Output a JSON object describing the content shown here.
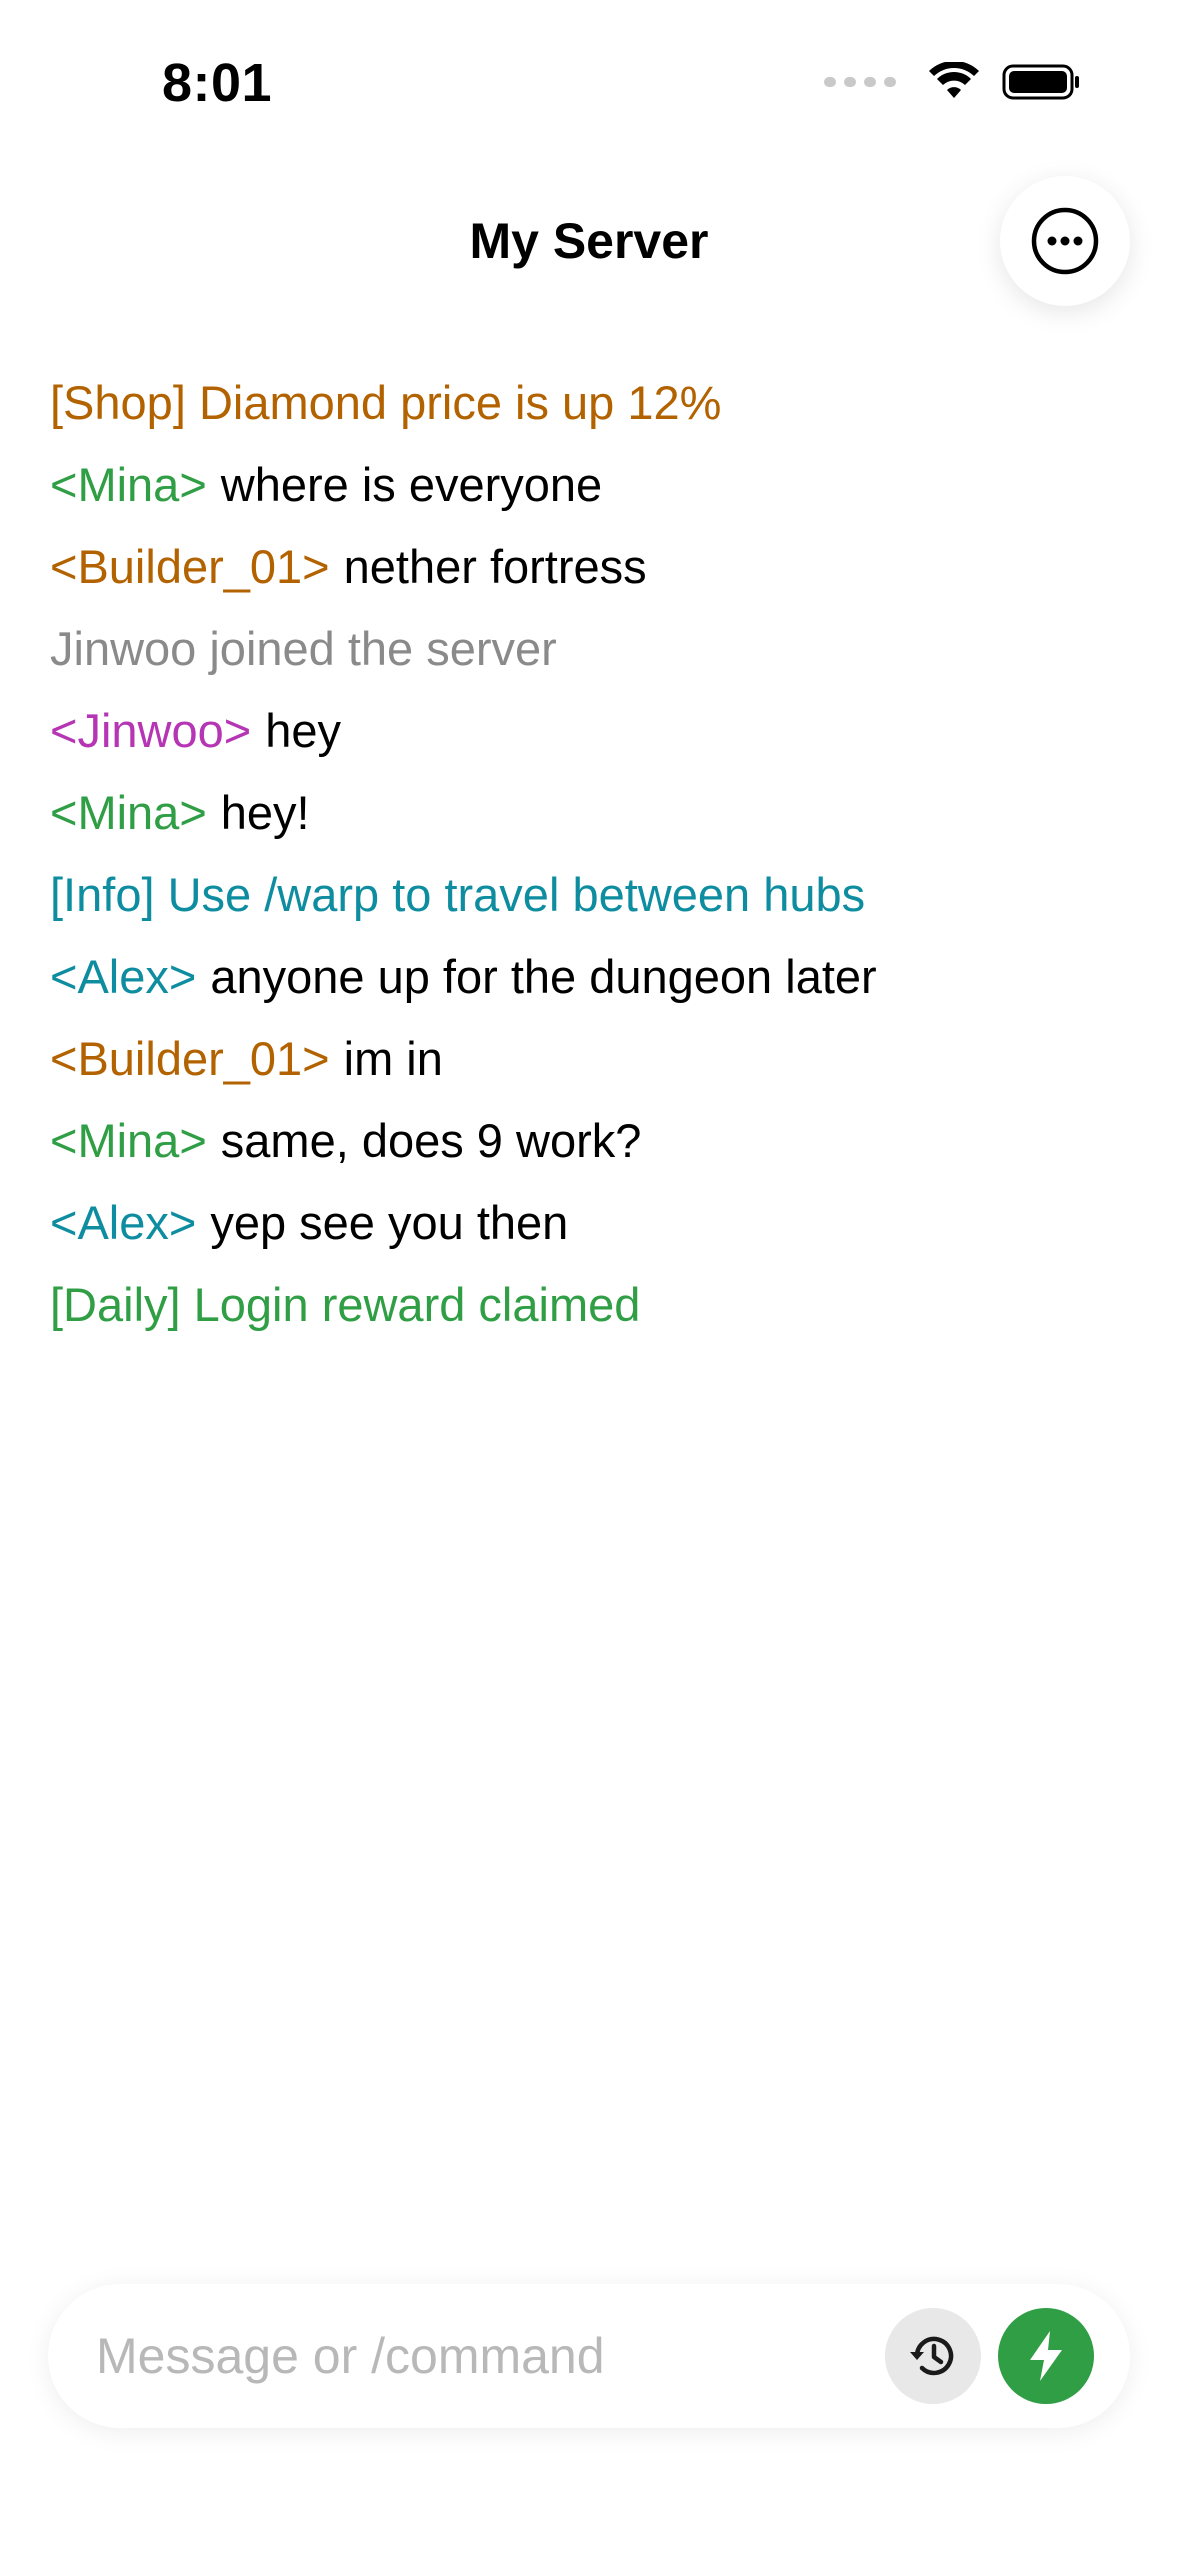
{
  "status_bar": {
    "time": "8:01"
  },
  "header": {
    "title": "My Server",
    "menu_icon": "ellipsis-circle-icon"
  },
  "colors": {
    "shop": "#b36200",
    "info": "#0e8da0",
    "daily": "#2f9e44",
    "system": "#8a8a8a",
    "message": "#000000",
    "mina": "#2f9e44",
    "builder": "#b36200",
    "jinwoo": "#b535b5",
    "alex": "#0e8da0",
    "send_button": "#2f9e44"
  },
  "chat": {
    "lines": [
      {
        "text": "[Shop] Diamond price is up 12%",
        "color": "#b36200"
      },
      {
        "name": "<Mina>",
        "name_color": "#2f9e44",
        "text": "where is everyone"
      },
      {
        "name": "<Builder_01>",
        "name_color": "#b36200",
        "text": "nether fortress"
      },
      {
        "text": "Jinwoo joined the server",
        "color": "#8a8a8a"
      },
      {
        "name": "<Jinwoo>",
        "name_color": "#b535b5",
        "text": "hey"
      },
      {
        "name": "<Mina>",
        "name_color": "#2f9e44",
        "text": "hey!"
      },
      {
        "text": "[Info] Use /warp to travel between hubs",
        "color": "#0e8da0"
      },
      {
        "name": "<Alex>",
        "name_color": "#0e8da0",
        "text": "anyone up for the dungeon later"
      },
      {
        "name": "<Builder_01>",
        "name_color": "#b36200",
        "text": "im in"
      },
      {
        "name": "<Mina>",
        "name_color": "#2f9e44",
        "text": "same, does 9 work?"
      },
      {
        "name": "<Alex>",
        "name_color": "#0e8da0",
        "text": "yep see you then"
      },
      {
        "text": "[Daily] Login reward claimed",
        "color": "#2f9e44"
      }
    ]
  },
  "composer": {
    "placeholder": "Message or /command",
    "value": "",
    "history_icon": "history-icon",
    "send_icon": "bolt-icon"
  }
}
